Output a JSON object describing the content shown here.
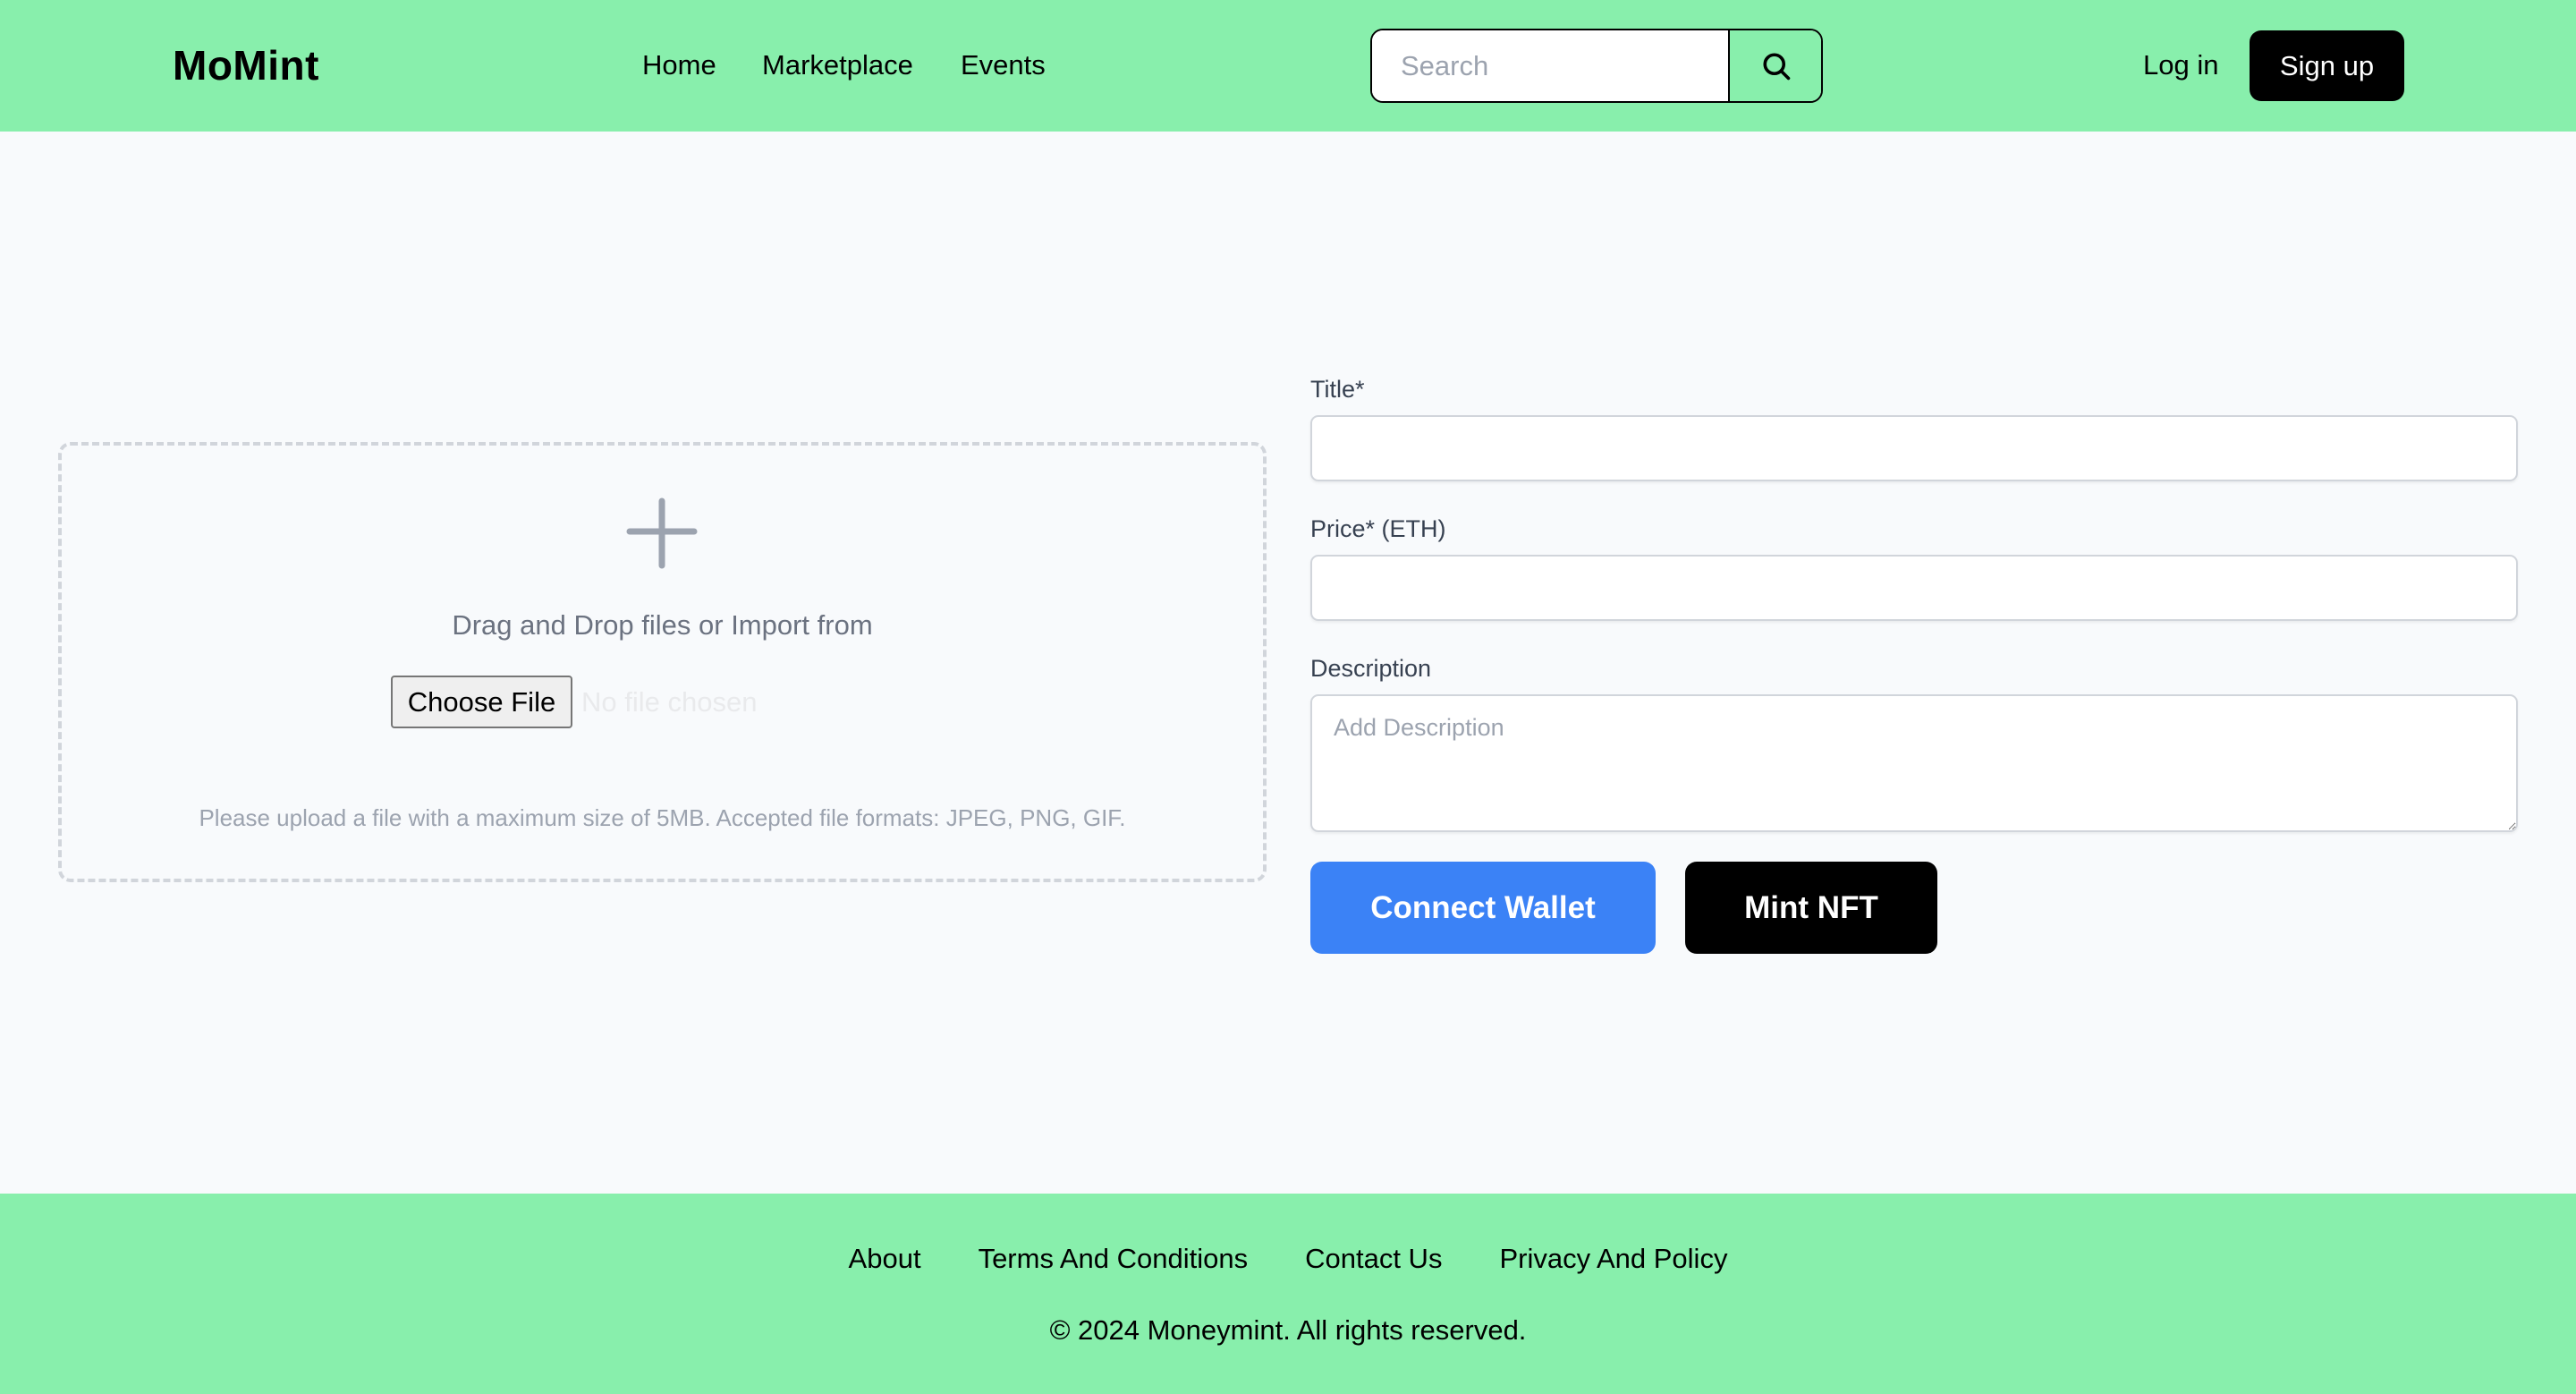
{
  "header": {
    "logo": "MoMint",
    "nav": [
      {
        "label": "Home"
      },
      {
        "label": "Marketplace"
      },
      {
        "label": "Events"
      }
    ],
    "search": {
      "placeholder": "Search",
      "value": "",
      "button_icon": "search-icon"
    },
    "login_label": "Log in",
    "signup_label": "Sign up"
  },
  "upload": {
    "icon": "plus-icon",
    "drop_text": "Drag and Drop files or Import from",
    "choose_file_label": "Choose File",
    "no_file_text": "No file chosen",
    "hint": "Please upload a file with a maximum size of 5MB. Accepted file formats: JPEG, PNG, GIF."
  },
  "form": {
    "title": {
      "label": "Title*",
      "value": "",
      "placeholder": ""
    },
    "price": {
      "label": "Price* (ETH)",
      "value": "",
      "placeholder": ""
    },
    "description": {
      "label": "Description",
      "value": "",
      "placeholder": "Add Description"
    },
    "connect_wallet_label": "Connect Wallet",
    "mint_label": "Mint NFT"
  },
  "footer": {
    "links": [
      {
        "label": "About"
      },
      {
        "label": "Terms And Conditions"
      },
      {
        "label": "Contact Us"
      },
      {
        "label": "Privacy And Policy"
      }
    ],
    "copyright": "© 2024 Moneymint. All rights reserved."
  },
  "colors": {
    "brand_green": "#88EFAC",
    "page_background": "#F8FAFC",
    "primary_blue": "#3B82F6",
    "black": "#000000",
    "muted_text": "#6B7280",
    "placeholder_text": "#9CA3AF",
    "border_gray": "#D1D5DB"
  }
}
